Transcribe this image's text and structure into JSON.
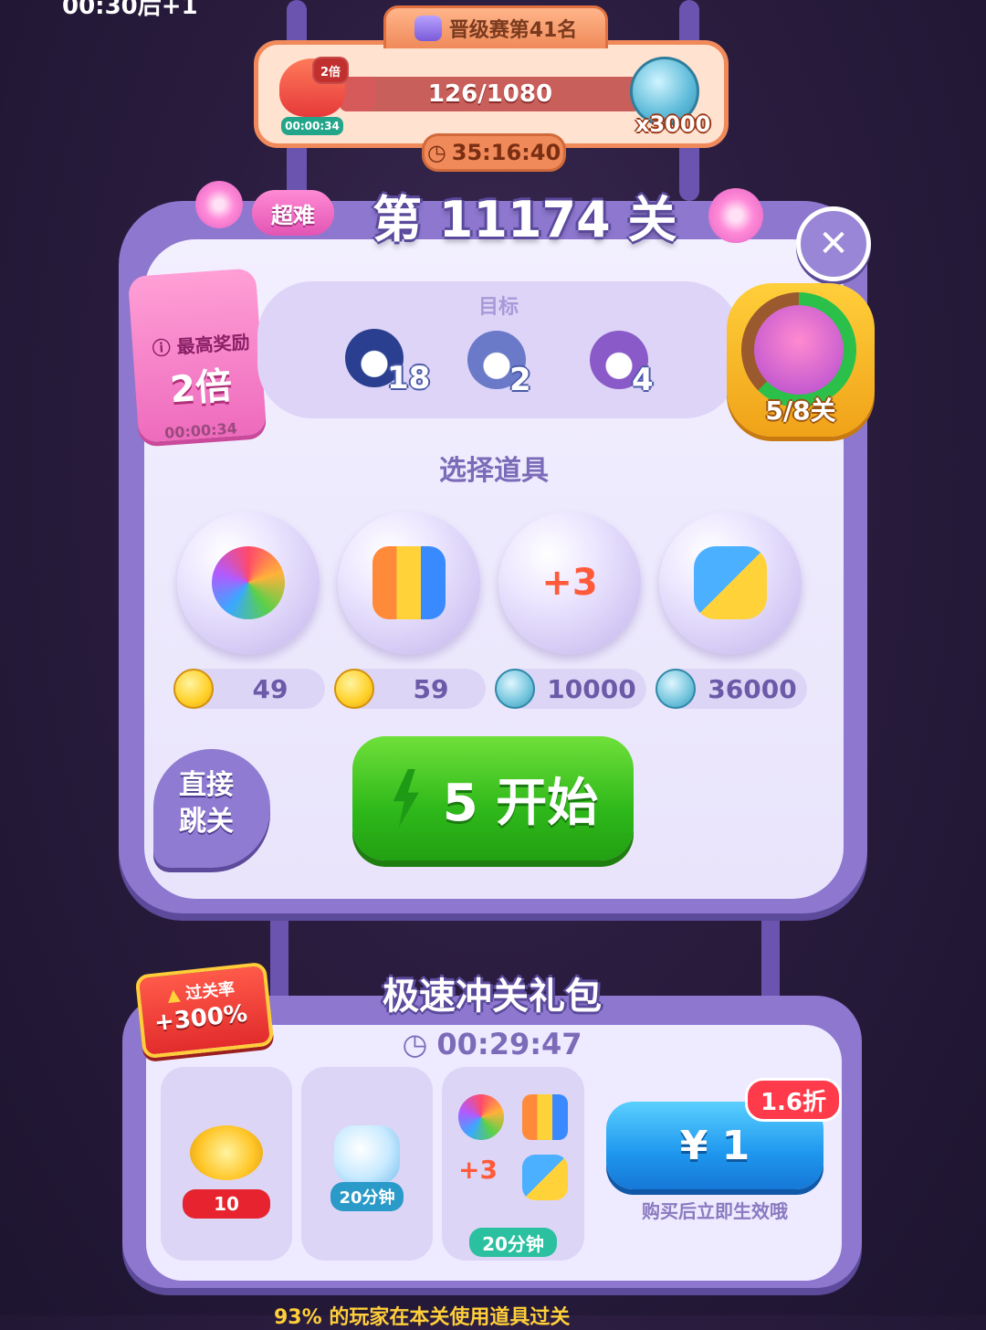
{
  "status": {
    "time_text": "00:30后+1"
  },
  "event": {
    "title": "晋级赛第41名",
    "progress_text": "126/1080",
    "progress_fraction": 0.1167,
    "multiplier_badge": "2倍",
    "fox_timer": "00:00:34",
    "coin_multiplier": "x3000",
    "countdown": "35:16:40"
  },
  "level": {
    "title": "第 11174 关",
    "difficulty": "超难",
    "close_icon": "close-icon"
  },
  "reward": {
    "label": "最高奖励",
    "value": "2倍",
    "timer": "00:00:34"
  },
  "goals": {
    "title": "目标",
    "items": [
      {
        "icon": "penguin-icon",
        "count": "18",
        "color": "#2a3f8f"
      },
      {
        "icon": "sailor-penguin-icon",
        "count": "2",
        "color": "#6a7ac8"
      },
      {
        "icon": "purple-hat-bird-icon",
        "count": "4",
        "color": "#8a5ac8"
      }
    ]
  },
  "level_progress": {
    "text": "5/8关",
    "fraction": 0.625
  },
  "boosters": {
    "title": "选择道具",
    "items": [
      {
        "icon": "rainbow-owl-icon",
        "price": "49",
        "currency": "gold-coin-icon"
      },
      {
        "icon": "rocket-bundle-icon",
        "price": "59",
        "currency": "gold-coin-icon"
      },
      {
        "icon": "plus-three-moves-icon",
        "price": "10000",
        "currency": "silver-coin-icon"
      },
      {
        "icon": "swap-creatures-icon",
        "price": "36000",
        "currency": "silver-coin-icon"
      }
    ]
  },
  "actions": {
    "skip_line1": "直接",
    "skip_line2": "跳关",
    "start_label": "5 开始"
  },
  "bundle": {
    "title": "极速冲关礼包",
    "timer": "00:29:47",
    "rate_title": "过关率",
    "rate_value": "+300%",
    "cards": [
      {
        "icon": "gold-coin-pile-icon",
        "chip": "10"
      },
      {
        "icon": "infinite-life-bottle-icon",
        "chip": "20分钟"
      },
      {
        "icon": "booster-set-icon",
        "chip": "20分钟"
      }
    ],
    "price": "¥ 1",
    "discount": "1.6折",
    "note": "购买后立即生效哦"
  },
  "footer": {
    "text": "93% 的玩家在本关使用道具过关"
  },
  "colors": {
    "panel_frame": "#8d77cf",
    "start_green": "#2eb81a",
    "buy_blue": "#1e96ee",
    "accent_pink": "#ee6bbd",
    "accent_orange": "#f08a5a"
  }
}
